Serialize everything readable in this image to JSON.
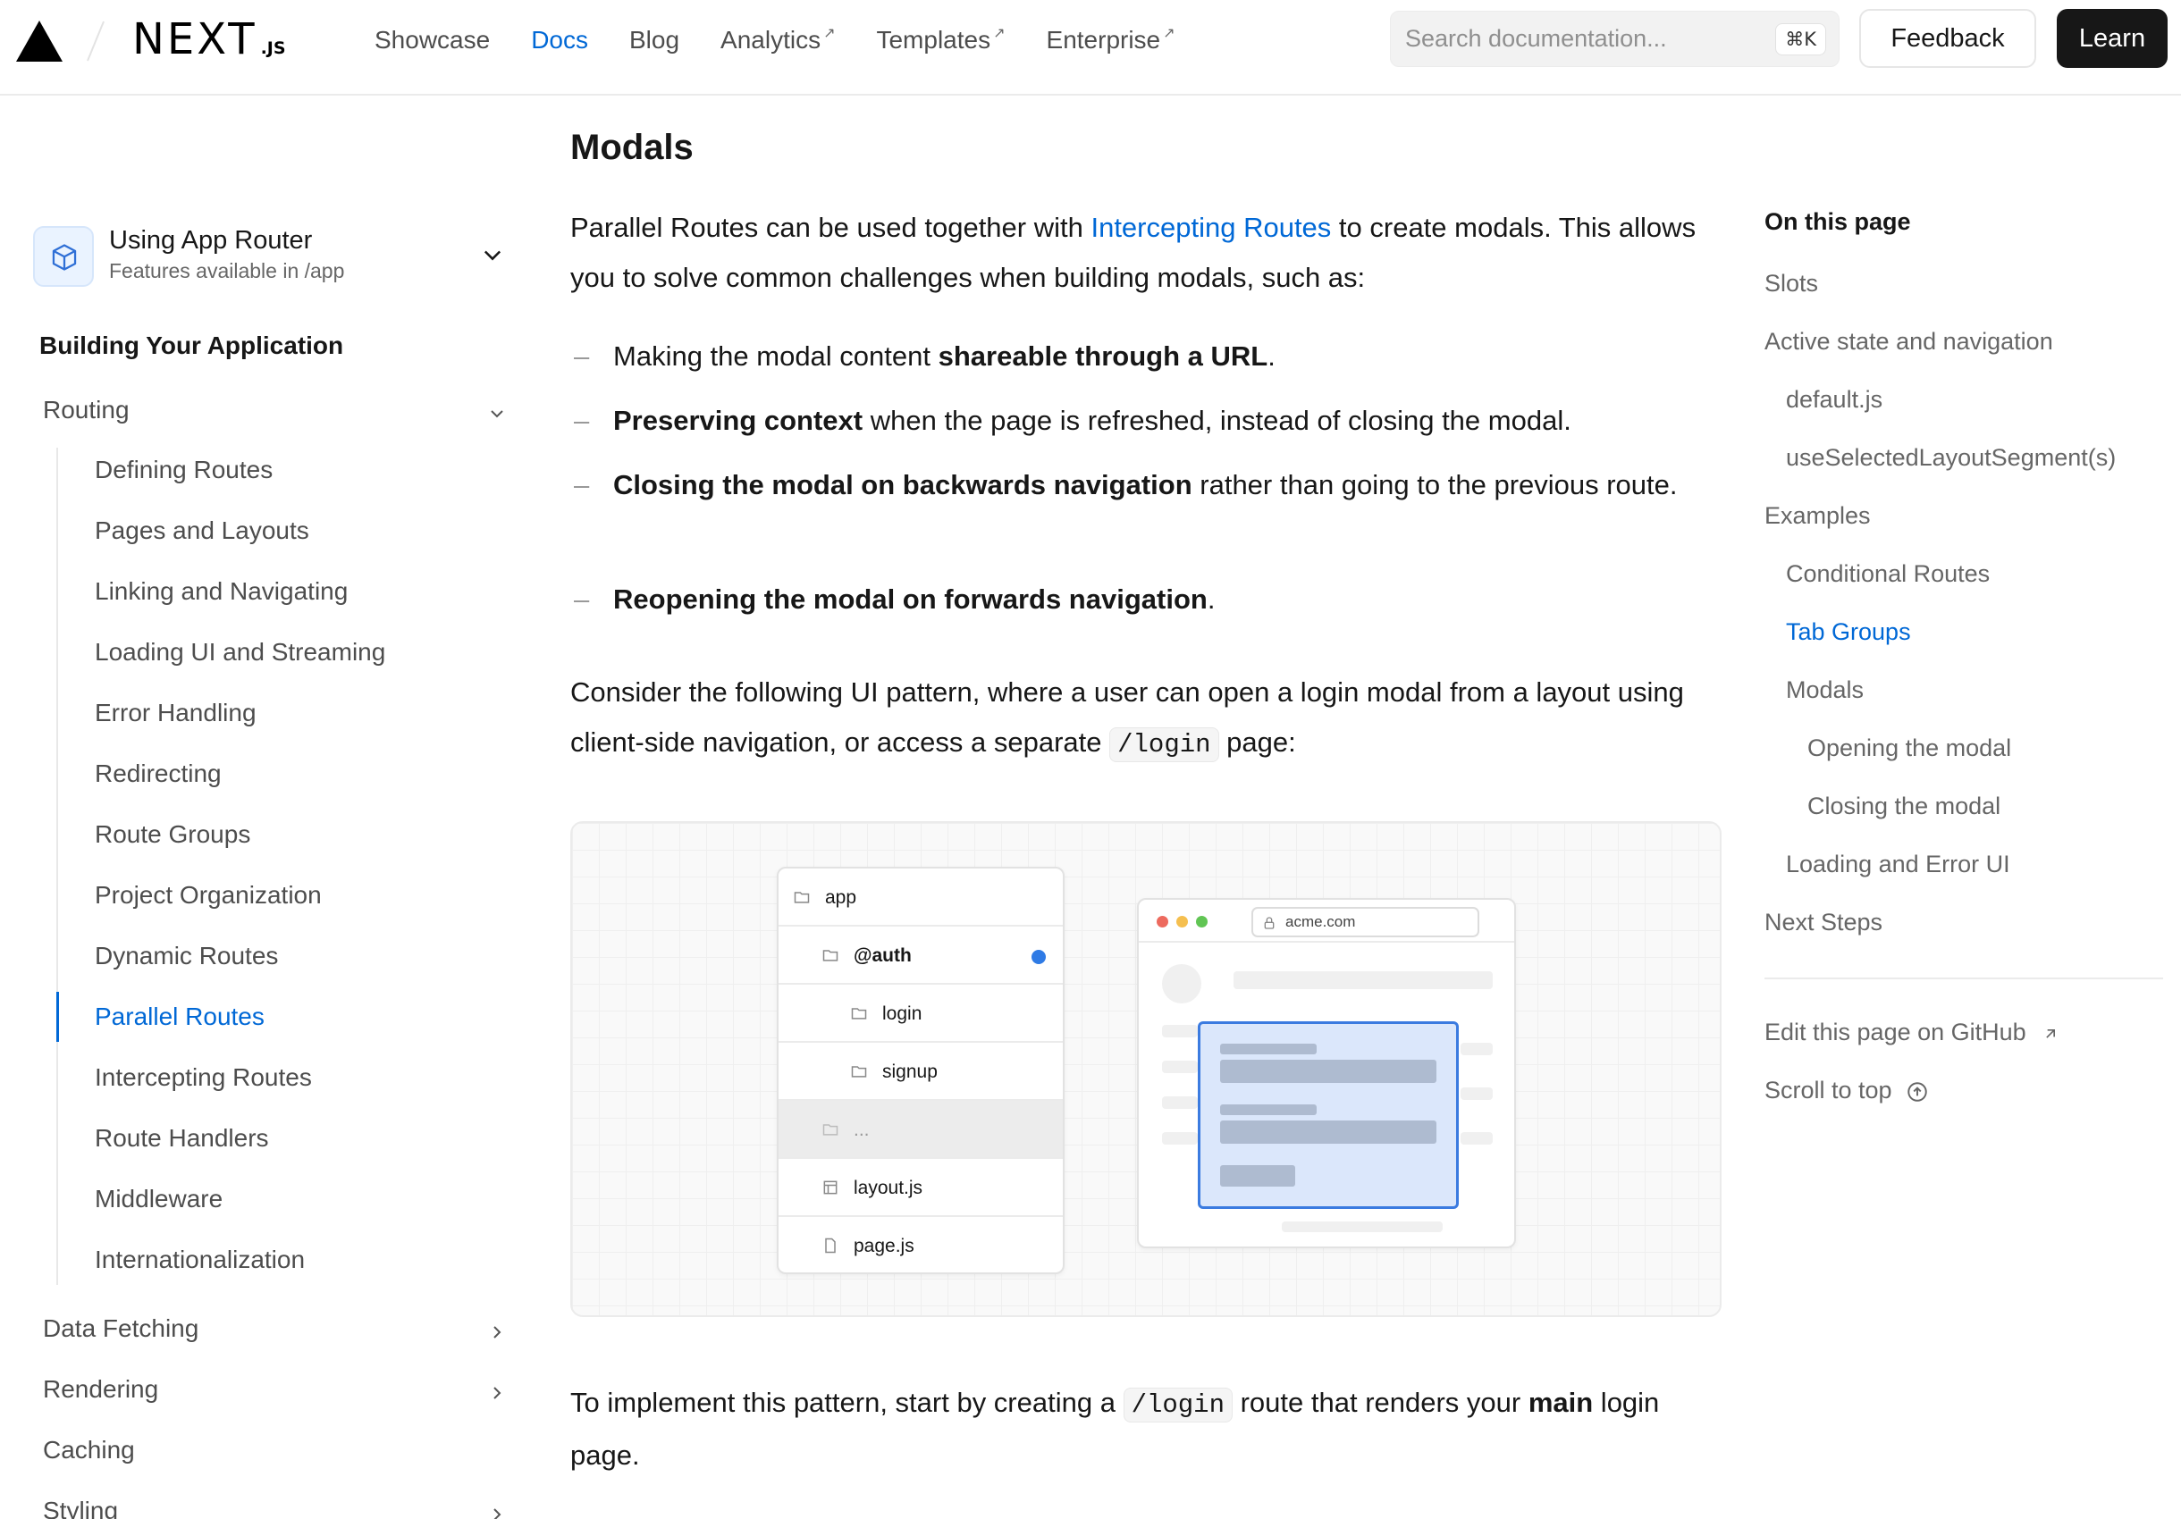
{
  "header": {
    "brand": "NEXT",
    "brand_suffix": ".JS",
    "nav": [
      {
        "label": "Showcase",
        "external": false,
        "active": false
      },
      {
        "label": "Docs",
        "external": false,
        "active": true
      },
      {
        "label": "Blog",
        "external": false,
        "active": false
      },
      {
        "label": "Analytics",
        "external": true,
        "active": false
      },
      {
        "label": "Templates",
        "external": true,
        "active": false
      },
      {
        "label": "Enterprise",
        "external": true,
        "active": false
      }
    ],
    "external_glyph": "↗",
    "search_placeholder": "Search documentation...",
    "search_shortcut": "⌘K",
    "feedback_label": "Feedback",
    "learn_label": "Learn"
  },
  "sidebar": {
    "router_title": "Using App Router",
    "router_subtitle": "Features available in /app",
    "section_title": "Building Your Application",
    "routing_label": "Routing",
    "routing_items": [
      "Defining Routes",
      "Pages and Layouts",
      "Linking and Navigating",
      "Loading UI and Streaming",
      "Error Handling",
      "Redirecting",
      "Route Groups",
      "Project Organization",
      "Dynamic Routes",
      "Parallel Routes",
      "Intercepting Routes",
      "Route Handlers",
      "Middleware",
      "Internationalization"
    ],
    "active_item": "Parallel Routes",
    "groups": [
      "Data Fetching",
      "Rendering",
      "Caching",
      "Styling"
    ]
  },
  "content": {
    "heading": "Modals",
    "intro_1": "Parallel Routes can be used together with ",
    "intro_link": "Intercepting Routes",
    "intro_2": " to create modals. This allows you to solve common challenges when building modals, such as:",
    "bullet_glyph": "–",
    "bullets": [
      {
        "pre": "Making the modal content ",
        "bold": "shareable through a URL",
        "post": "."
      },
      {
        "pre": "",
        "bold": "Preserving context",
        "post": " when the page is refreshed, instead of closing the modal."
      },
      {
        "pre": "",
        "bold": "Closing the modal on backwards navigation",
        "post": " rather than going to the previous route."
      },
      {
        "pre": "",
        "bold": "Reopening the modal on forwards navigation",
        "post": "."
      }
    ],
    "consider_1": "Consider the following UI pattern, where a user can open a login modal from a layout using client-side navigation, or access a separate ",
    "consider_code": "/login",
    "consider_2": " page:",
    "implement_1": "To implement this pattern, start by creating a ",
    "implement_code": "/login",
    "implement_2": " route that renders your ",
    "implement_bold": "main",
    "implement_3": " login page."
  },
  "figure": {
    "tree": [
      "app",
      "@auth",
      "login",
      "signup",
      "...",
      "layout.js",
      "page.js"
    ],
    "url": "acme.com",
    "accent": "#3b7be0"
  },
  "toc": {
    "title": "On this page",
    "items": [
      {
        "label": "Slots",
        "level": 0,
        "active": false
      },
      {
        "label": "Active state and navigation",
        "level": 0,
        "active": false
      },
      {
        "label": "default.js",
        "level": 1,
        "active": false
      },
      {
        "label": "useSelectedLayoutSegment(s)",
        "level": 1,
        "active": false
      },
      {
        "label": "Examples",
        "level": 0,
        "active": false
      },
      {
        "label": "Conditional Routes",
        "level": 1,
        "active": false
      },
      {
        "label": "Tab Groups",
        "level": 1,
        "active": true
      },
      {
        "label": "Modals",
        "level": 1,
        "active": false
      },
      {
        "label": "Opening the modal",
        "level": 2,
        "active": false
      },
      {
        "label": "Closing the modal",
        "level": 2,
        "active": false
      },
      {
        "label": "Loading and Error UI",
        "level": 1,
        "active": false
      },
      {
        "label": "Next Steps",
        "level": 0,
        "active": false
      }
    ],
    "edit_label": "Edit this page on GitHub",
    "scroll_label": "Scroll to top"
  },
  "colors": {
    "accent": "#0068d6",
    "text": "#171717",
    "muted": "#666666"
  }
}
